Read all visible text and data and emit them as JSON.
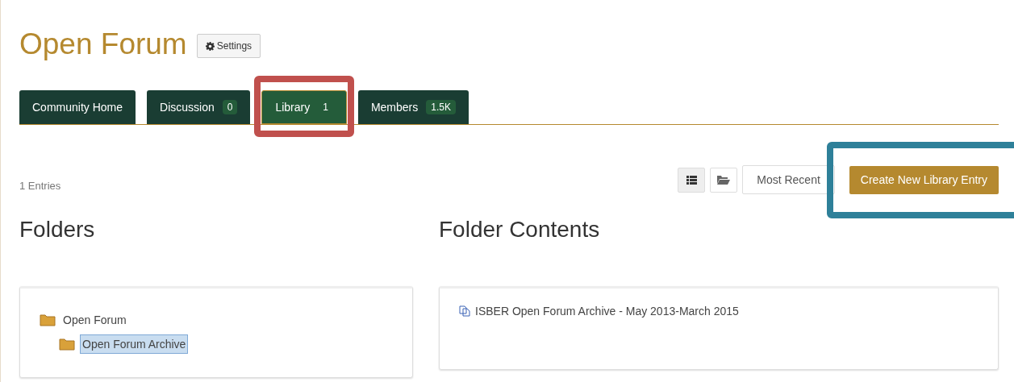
{
  "title": "Open Forum",
  "settings_button": {
    "label": "Settings"
  },
  "tabs": [
    {
      "label": "Community Home",
      "selected": false,
      "highlighted": false
    },
    {
      "label": "Discussion",
      "count": "0",
      "selected": false,
      "highlighted": false
    },
    {
      "label": "Library",
      "count": "1",
      "selected": true,
      "highlighted": true
    },
    {
      "label": "Members",
      "count": "1.5K",
      "selected": false,
      "highlighted": false
    }
  ],
  "entries_count": "1 Entries",
  "view_buttons": [
    {
      "kind": "list",
      "selected": true
    },
    {
      "kind": "folder",
      "selected": false
    }
  ],
  "sort_button": {
    "label": "Most Recent"
  },
  "create_button": {
    "label": "Create New Library Entry",
    "highlighted": true
  },
  "folders": {
    "heading": "Folders",
    "tree": [
      {
        "label": "Open Forum",
        "selected": false,
        "children": [
          {
            "label": "Open Forum Archive",
            "selected": true
          }
        ]
      }
    ]
  },
  "contents": {
    "heading": "Folder Contents",
    "items": [
      "ISBER Open Forum Archive - May 2013-March 2015"
    ]
  }
}
